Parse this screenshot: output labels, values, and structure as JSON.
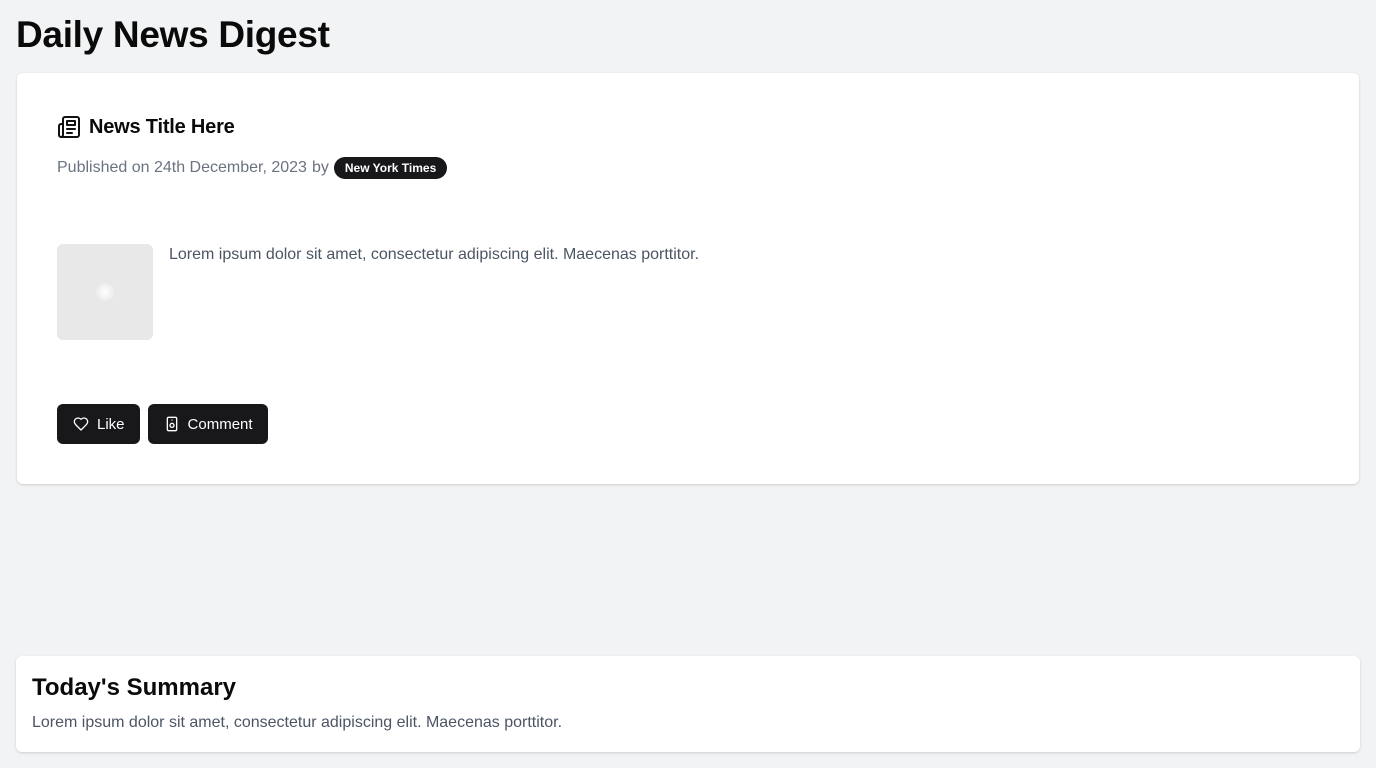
{
  "page": {
    "title": "Daily News Digest"
  },
  "news_card": {
    "icon": "newspaper-icon",
    "title": "News Title Here",
    "published_text": "Published on 24th December, 2023",
    "by_text": "by",
    "source": "New York Times",
    "thumbnail_icon": "image-placeholder",
    "excerpt": "Lorem ipsum dolor sit amet, consectetur adipiscing elit. Maecenas porttitor.",
    "actions": {
      "like_label": "Like",
      "like_icon": "heart-icon",
      "comment_label": "Comment",
      "comment_icon": "comment-icon"
    }
  },
  "summary": {
    "title": "Today's Summary",
    "text": "Lorem ipsum dolor sit amet, consectetur adipiscing elit. Maecenas porttitor."
  },
  "colors": {
    "background": "#f2f3f5",
    "card": "#ffffff",
    "button": "#18181b",
    "muted_text": "#6b7280"
  }
}
